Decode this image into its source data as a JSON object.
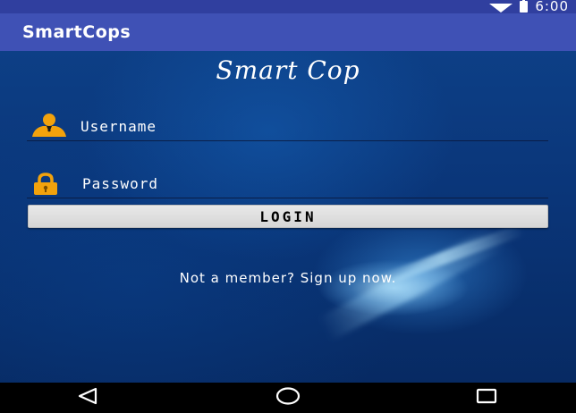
{
  "status_bar": {
    "time": "6:00",
    "icons": [
      "wifi-icon",
      "battery-icon"
    ]
  },
  "app_bar": {
    "title": "SmartCops",
    "background": "#3f51b5",
    "status_background": "#303f9f"
  },
  "login": {
    "brand_title": "Smart Cop",
    "username_placeholder": "Username",
    "password_placeholder": "Password",
    "login_label": "LOGIN",
    "signup_text": "Not a member? Sign up now.",
    "username_icon": "user-icon",
    "password_icon": "lock-icon"
  },
  "nav_bar": {
    "buttons": [
      "back-icon",
      "home-icon",
      "recents-icon"
    ]
  },
  "colors": {
    "icon_gold": "#f2a20c",
    "login_button": "#e0e0e0"
  }
}
